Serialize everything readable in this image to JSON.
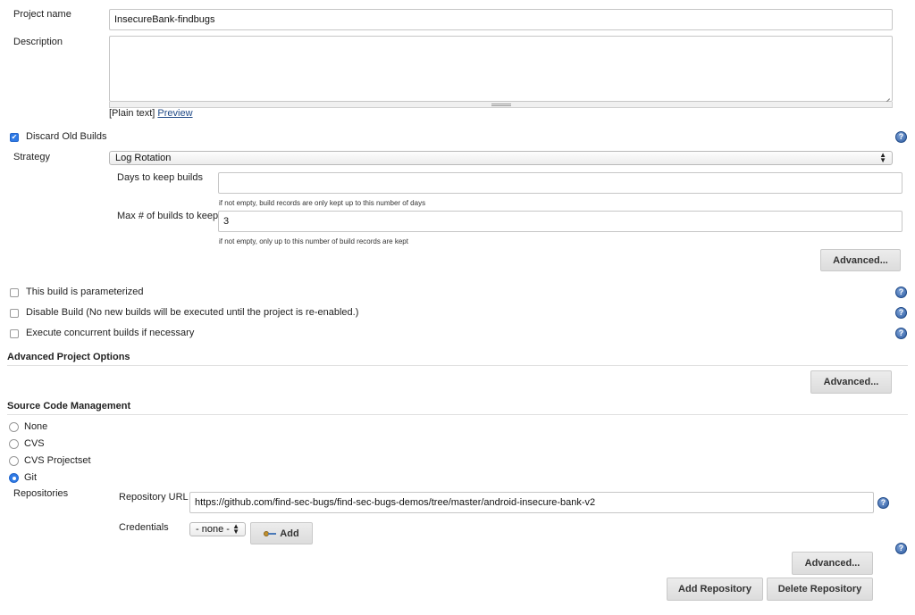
{
  "project": {
    "name_label": "Project name",
    "name_value": "InsecureBank-findbugs",
    "description_label": "Description",
    "description_value": "",
    "format_text": "[Plain text]",
    "preview_link": "Preview"
  },
  "discard": {
    "label": "Discard Old Builds",
    "checked": true,
    "strategy_label": "Strategy",
    "strategy_value": "Log Rotation",
    "days_label": "Days to keep builds",
    "days_value": "",
    "days_hint": "if not empty, build records are only kept up to this number of days",
    "max_label": "Max # of builds to keep",
    "max_value": "3",
    "max_hint": "if not empty, only up to this number of build records are kept",
    "advanced_button": "Advanced..."
  },
  "options": [
    {
      "label": "This build is parameterized",
      "checked": false
    },
    {
      "label": "Disable Build (No new builds will be executed until the project is re-enabled.)",
      "checked": false
    },
    {
      "label": "Execute concurrent builds if necessary",
      "checked": false
    }
  ],
  "advanced_project": {
    "title": "Advanced Project Options",
    "advanced_button": "Advanced..."
  },
  "scm": {
    "title": "Source Code Management",
    "radios": [
      {
        "label": "None",
        "checked": false
      },
      {
        "label": "CVS",
        "checked": false
      },
      {
        "label": "CVS Projectset",
        "checked": false
      },
      {
        "label": "Git",
        "checked": true
      }
    ],
    "repositories_label": "Repositories",
    "repo_url_label": "Repository URL",
    "repo_url_value": "https://github.com/find-sec-bugs/find-sec-bugs-demos/tree/master/android-insecure-bank-v2",
    "credentials_label": "Credentials",
    "credentials_value": "- none -",
    "add_button": "Add",
    "advanced_button": "Advanced...",
    "add_repo_button": "Add Repository",
    "delete_repo_button": "Delete Repository"
  },
  "help_glyph": "?",
  "colors": {
    "help": "#2c5aa0",
    "check": "#2f7ae5",
    "link": "#204a87"
  }
}
